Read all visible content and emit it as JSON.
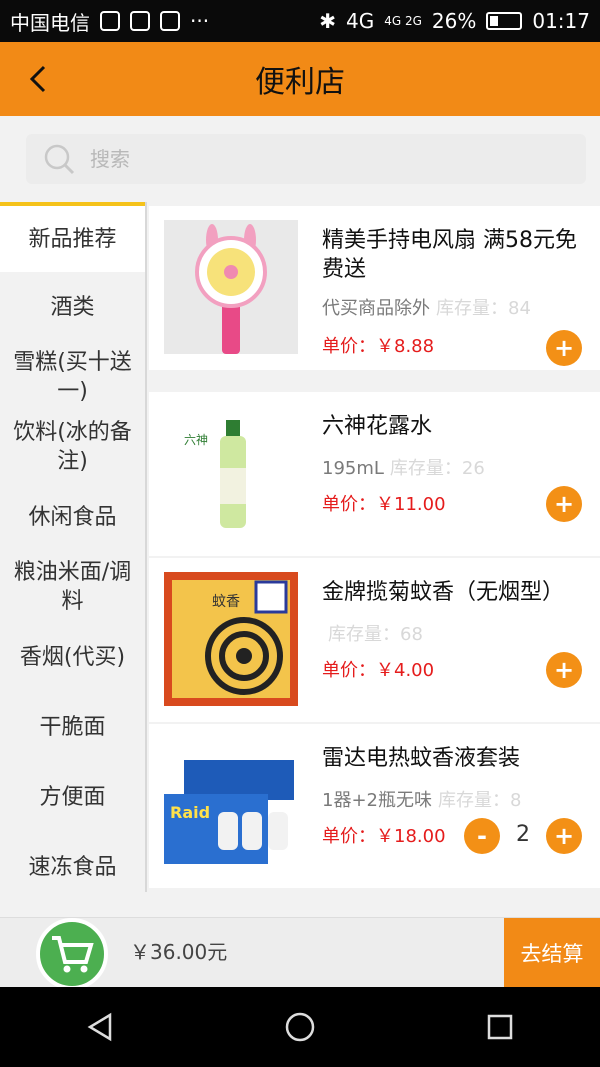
{
  "status_bar": {
    "carrier": "中国电信",
    "network_top": "4G",
    "network_mid": "4G 2G",
    "battery": "26%",
    "time": "01:17"
  },
  "header": {
    "title": "便利店"
  },
  "search": {
    "placeholder": "搜索"
  },
  "categories": [
    "新品推荐",
    "酒类",
    "雪糕(买十送一)",
    "饮料(冰的备注)",
    "休闲食品",
    "粮油米面/调料",
    "香烟(代买)",
    "干脆面",
    "方便面",
    "速冻食品"
  ],
  "products": [
    {
      "name": "精美手持电风扇 满58元免费送",
      "spec": "代买商品除外",
      "stock": "库存量：84",
      "price": "单价：￥8.88",
      "add": "+"
    },
    {
      "name": "六神花露水",
      "spec": "195mL",
      "stock": "库存量：26",
      "price": "单价：￥11.00",
      "add": "+"
    },
    {
      "name": "金牌揽菊蚊香（无烟型）",
      "spec": "",
      "stock": "库存量：68",
      "price": "单价：￥4.00",
      "add": "+"
    },
    {
      "name": "雷达电热蚊香液套装",
      "spec": "1器+2瓶无味",
      "stock": "库存量：8",
      "price": "单价：￥18.00",
      "add": "+",
      "minus": "-",
      "qty": "2"
    }
  ],
  "product_images": [
    {
      "text": ""
    },
    {
      "text": "六神"
    },
    {
      "text": "蚊香"
    },
    {
      "text": "Raid"
    }
  ],
  "cart": {
    "total": "￥36.00元",
    "checkout": "去结算"
  },
  "colors": {
    "accent": "#f28a16",
    "price": "#e51c1c",
    "cart": "#4caf50"
  }
}
